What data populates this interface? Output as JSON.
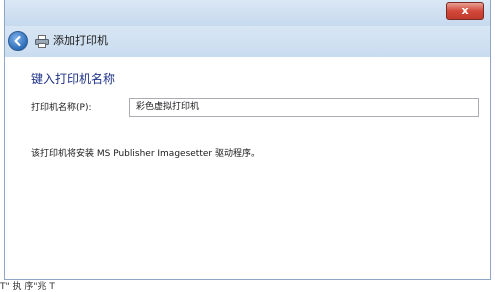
{
  "window": {
    "close_label": "x"
  },
  "nav": {
    "title": "添加打印机"
  },
  "content": {
    "heading": "键入打印机名称",
    "field_label": "打印机名称(P):",
    "printer_name_value": "彩色虚拟打印机",
    "info_text": "该打印机将安装 MS Publisher Imagesetter 驱动程序。"
  },
  "footer": {
    "fragment_text": "T\" 执 序\"兆 T"
  },
  "icons": {
    "back": "back-arrow-icon",
    "printer": "printer-icon",
    "close": "close-icon"
  },
  "colors": {
    "heading": "#1e3287",
    "titlebar": "#c6d9ee",
    "close_button": "#c0392b"
  }
}
